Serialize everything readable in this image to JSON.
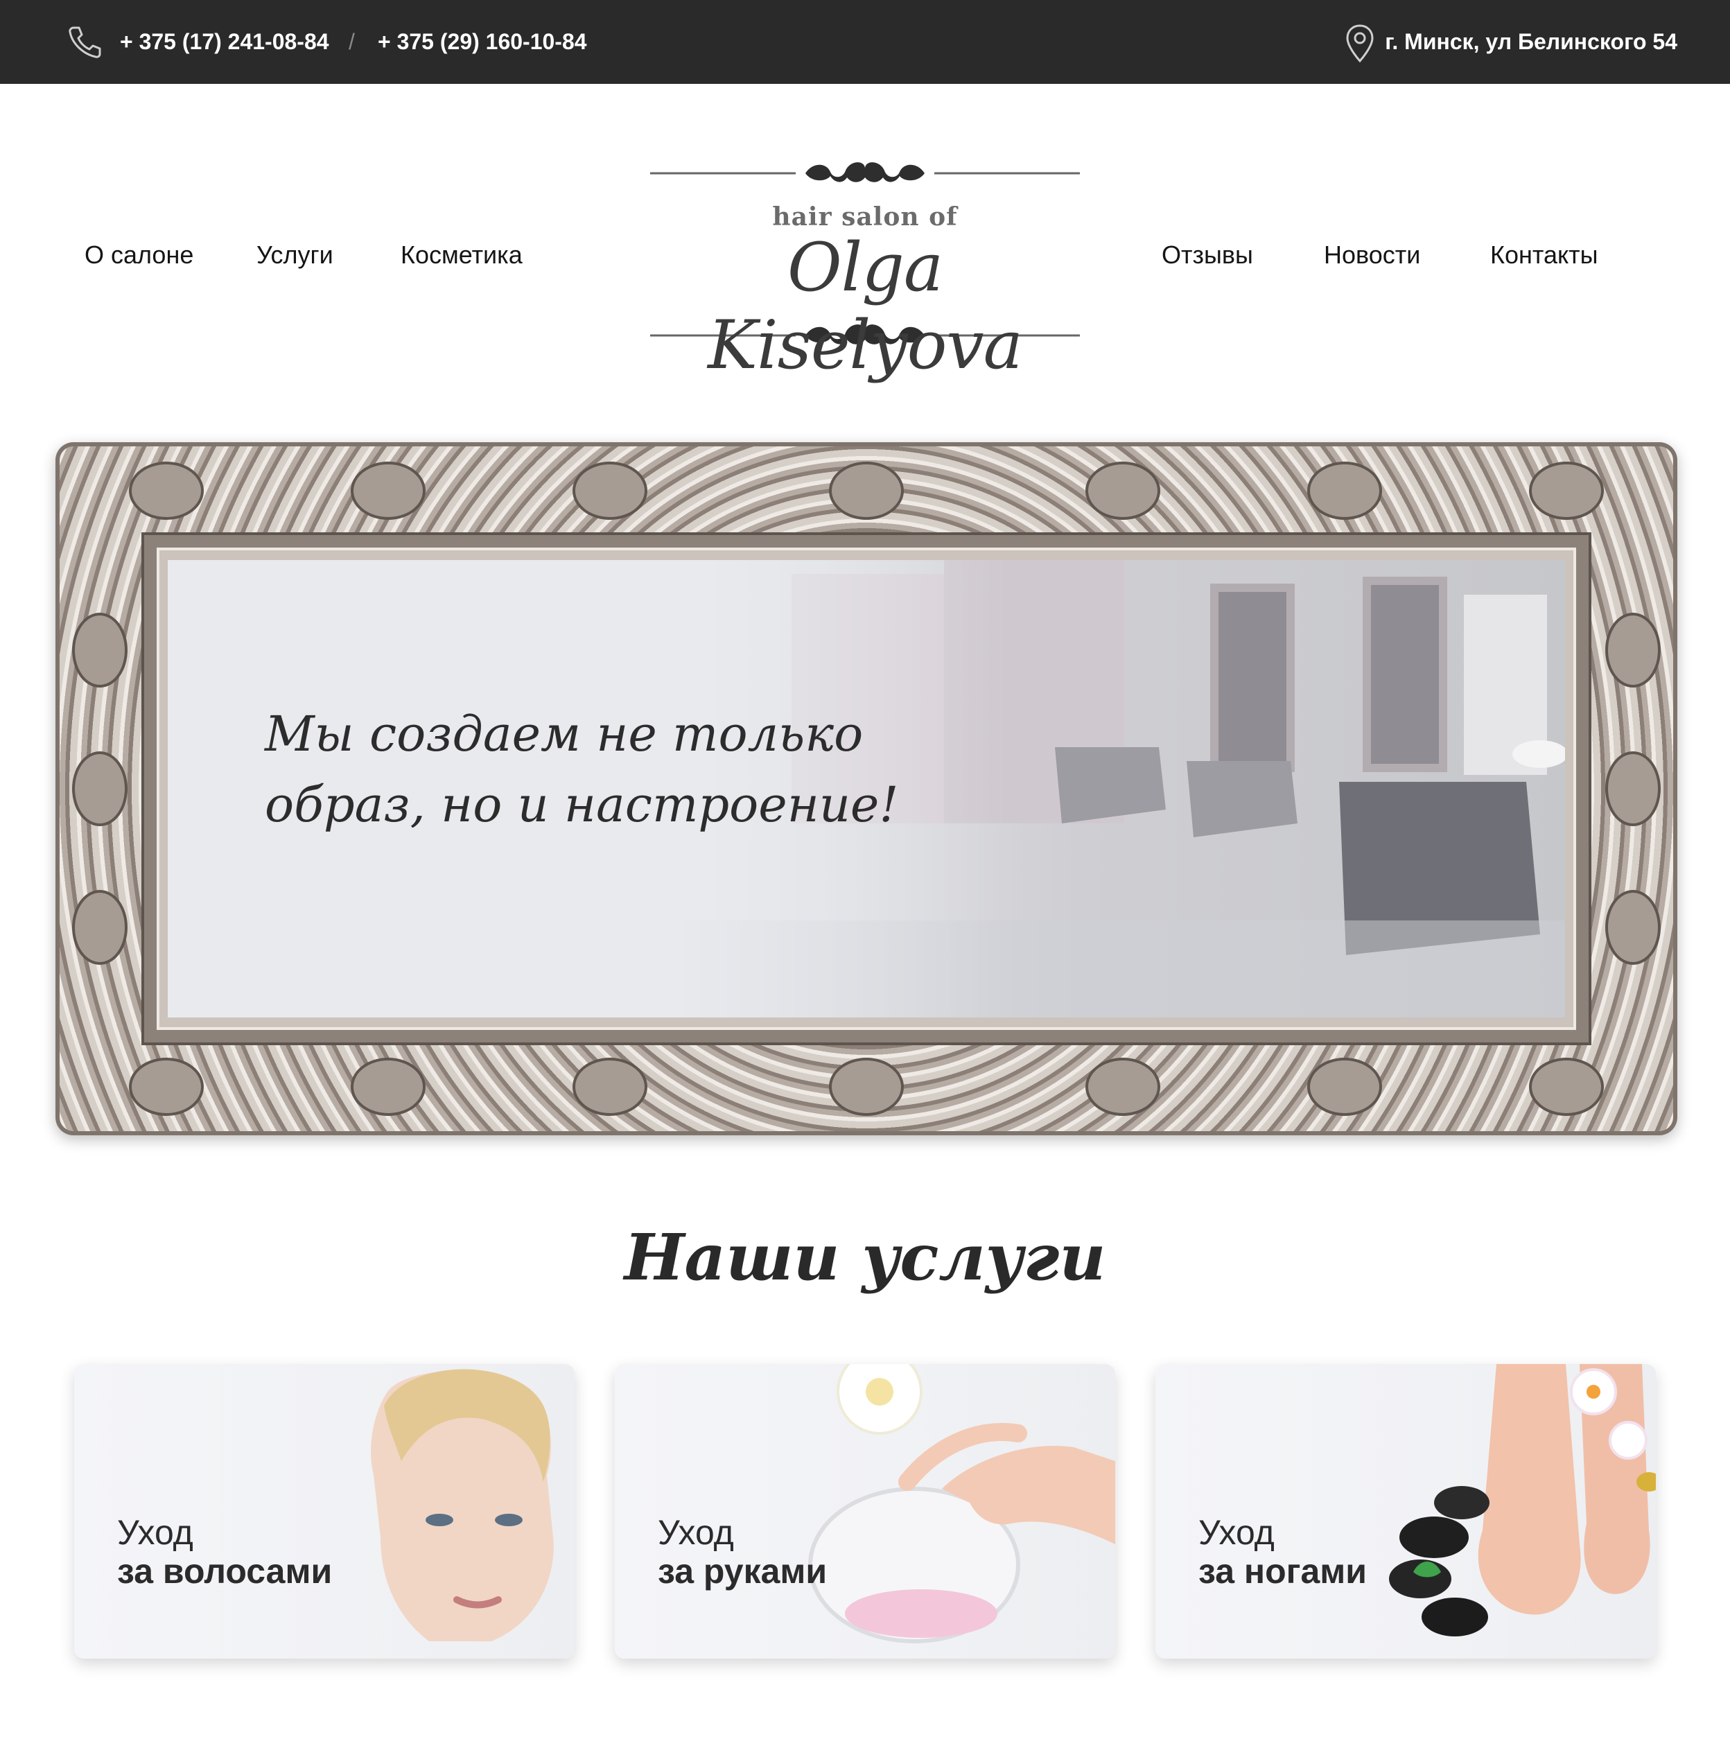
{
  "topbar": {
    "phone_1": "+ 375 (17) 241-08-84",
    "separator": "/",
    "phone_2": "+ 375 (29) 160-10-84",
    "address": "г. Минск, ул Белинского 54",
    "phone_icon": "phone-icon",
    "pin_icon": "map-pin-icon",
    "background": "#2a2a2a"
  },
  "nav": {
    "left": [
      "О салоне",
      "Услуги",
      "Косметика"
    ],
    "right": [
      "Отзывы",
      "Новости",
      "Контакты"
    ]
  },
  "logo": {
    "tagline": "hair salon of",
    "name": "Olga Kiselyova"
  },
  "hero": {
    "slogan_line_1": "Мы создаем не только",
    "slogan_line_2": "образ, но и настроение!"
  },
  "services": {
    "title": "Наши услуги",
    "cards": [
      {
        "line_1": "Уход",
        "line_2": "за волосами"
      },
      {
        "line_1": "Уход",
        "line_2": "за руками"
      },
      {
        "line_1": "Уход",
        "line_2": "за ногами"
      }
    ]
  }
}
